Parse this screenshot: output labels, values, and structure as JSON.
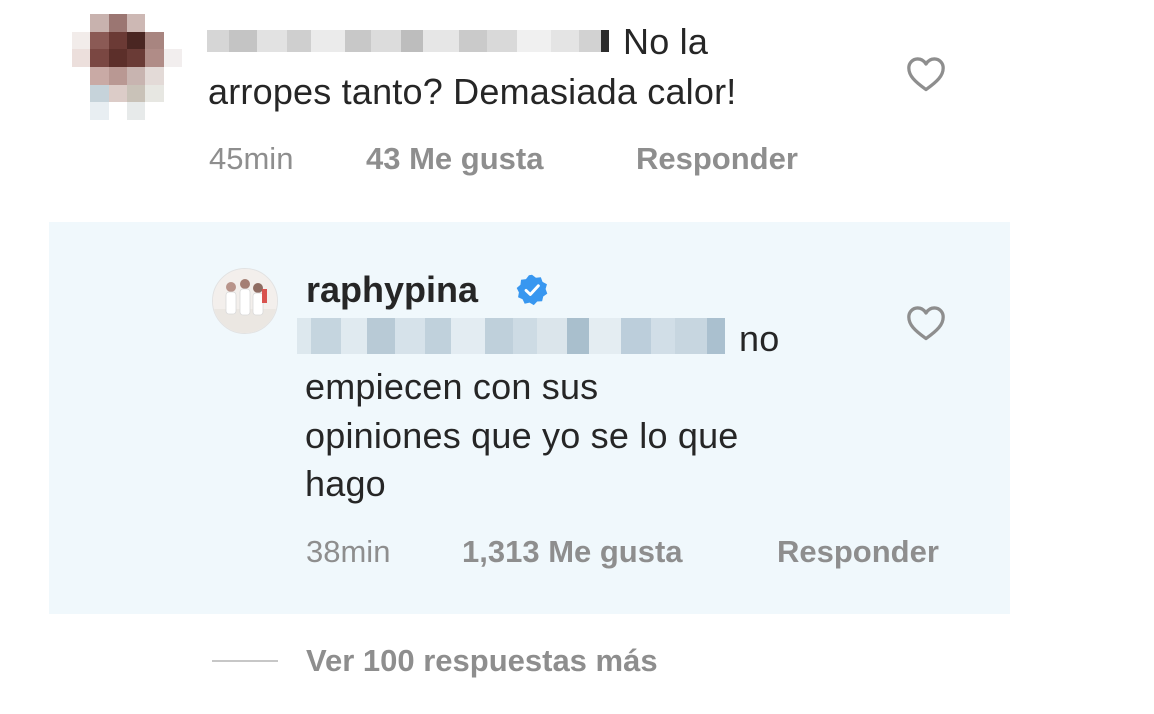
{
  "comment": {
    "text_line1": "No la",
    "text_line2": "arropes tanto? Demasiada calor!",
    "time": "45min",
    "likes": "43 Me gusta",
    "reply_label": "Responder"
  },
  "reply": {
    "username": "raphypina",
    "text_line1": "no",
    "text_line2": "empiecen con sus",
    "text_line3": "opiniones que yo se lo que",
    "text_line4": "hago",
    "time": "38min",
    "likes": "1,313 Me gusta",
    "reply_label": "Responder"
  },
  "view_more": "Ver 100 respuestas más",
  "icons": {
    "like": "heart-outline-icon",
    "verified": "verified-badge-icon"
  },
  "colors": {
    "text": "#262626",
    "secondary": "#8e8e8e",
    "reply_background": "#f0f8fc",
    "verified": "#3897f0"
  }
}
